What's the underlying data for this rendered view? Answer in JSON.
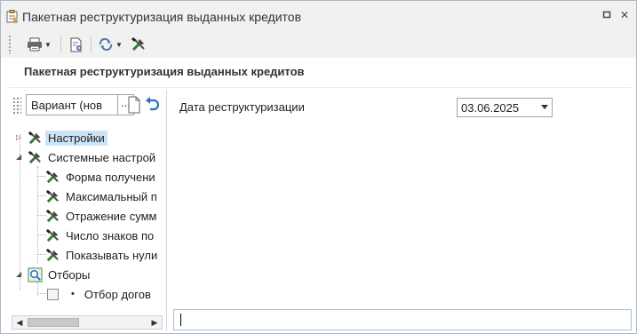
{
  "window": {
    "title": "Пакетная реструктуризация выданных кредитов",
    "buttons": {
      "restore": "◻",
      "close": "✕"
    }
  },
  "toolbar": {
    "items": [
      {
        "name": "print",
        "icon": "printer-icon",
        "has_dropdown": true
      },
      {
        "name": "settings-report",
        "icon": "document-gear-icon",
        "has_dropdown": false
      },
      {
        "name": "refresh",
        "icon": "refresh-icon",
        "has_dropdown": true
      },
      {
        "name": "tools",
        "icon": "tools-icon",
        "has_dropdown": false
      }
    ]
  },
  "form": {
    "header": "Пакетная реструктуризация выданных кредитов"
  },
  "variant": {
    "value": "Вариант (нов",
    "dots": "..."
  },
  "tree": {
    "items": [
      {
        "label": "Настройки",
        "icon": "tools-icon",
        "selected": true
      },
      {
        "label": "Системные настрой",
        "icon": "tools-icon",
        "selected": false
      },
      {
        "label": "Форма получени",
        "icon": "tools-icon",
        "selected": false
      },
      {
        "label": "Максимальный п",
        "icon": "tools-icon",
        "selected": false
      },
      {
        "label": "Отражение сумм",
        "icon": "tools-icon",
        "selected": false
      },
      {
        "label": "Число знаков по",
        "icon": "tools-icon",
        "selected": false
      },
      {
        "label": "Показывать нули",
        "icon": "tools-icon",
        "selected": false
      },
      {
        "label": "Отборы",
        "icon": "filter-magnifier-icon",
        "selected": false
      },
      {
        "label": "Отбор догов",
        "icon": "checkbox-icon",
        "selected": false
      }
    ]
  },
  "fields": {
    "restructuring_date": {
      "label": "Дата реструктуризации",
      "value": "03.06.2025"
    }
  },
  "colors": {
    "accent_selection": "#cce4f7",
    "toolbar_bg": "#f1f1f1",
    "input_border": "#a9bcd6"
  }
}
